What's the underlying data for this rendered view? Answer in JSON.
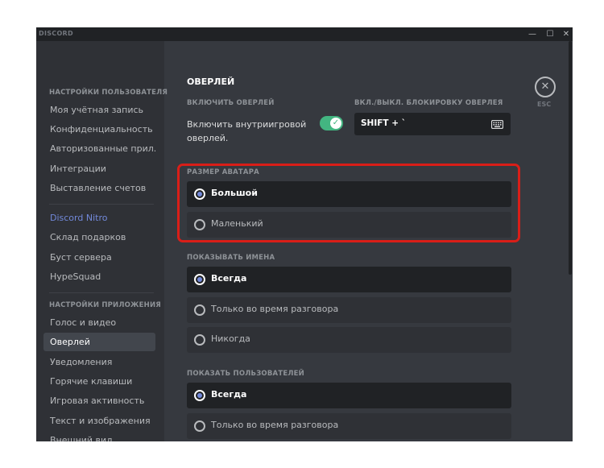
{
  "titlebar": {
    "app_name": "DISCORD",
    "minimize_glyph": "—",
    "maximize_glyph": "☐",
    "close_glyph": "✕"
  },
  "sidebar": {
    "user_settings_header": "НАСТРОЙКИ ПОЛЬЗОВАТЕЛЯ",
    "user_items": [
      {
        "label": "Моя учётная запись"
      },
      {
        "label": "Конфиденциальность"
      },
      {
        "label": "Авторизованные прил..."
      },
      {
        "label": "Интеграции"
      },
      {
        "label": "Выставление счетов"
      }
    ],
    "nitro_items": [
      {
        "label": "Discord Nitro"
      },
      {
        "label": "Склад подарков"
      },
      {
        "label": "Буст сервера"
      },
      {
        "label": "HypeSquad"
      }
    ],
    "app_settings_header": "НАСТРОЙКИ ПРИЛОЖЕНИЯ",
    "app_items": [
      {
        "label": "Голос и видео"
      },
      {
        "label": "Оверлей",
        "active": true
      },
      {
        "label": "Уведомления"
      },
      {
        "label": "Горячие клавиши"
      },
      {
        "label": "Игровая активность"
      },
      {
        "label": "Текст и изображения"
      },
      {
        "label": "Внешний вид"
      }
    ]
  },
  "content": {
    "title": "ОВЕРЛЕЙ",
    "close_glyph": "✕",
    "esc_label": "ESC",
    "enable_overlay": {
      "label": "ВКЛЮЧИТЬ ОВЕРЛЕЙ",
      "toggle_text": "Включить внутриигровой оверлей.",
      "enabled": true,
      "check_glyph": "✓"
    },
    "lock_keybind": {
      "label": "ВКЛ./ВЫКЛ. БЛОКИРОВКУ ОВЕРЛЕЯ",
      "value": "SHIFT + `"
    },
    "avatar_size": {
      "label": "РАЗМЕР АВАТАРА",
      "options": [
        {
          "label": "Большой",
          "selected": true
        },
        {
          "label": "Маленький",
          "selected": false
        }
      ]
    },
    "show_names": {
      "label": "ПОКАЗЫВАТЬ ИМЕНА",
      "options": [
        {
          "label": "Всегда",
          "selected": true
        },
        {
          "label": "Только во время разговора",
          "selected": false
        },
        {
          "label": "Никогда",
          "selected": false
        }
      ]
    },
    "show_users": {
      "label": "ПОКАЗАТЬ ПОЛЬЗОВАТЕЛЕЙ",
      "options": [
        {
          "label": "Всегда",
          "selected": true
        },
        {
          "label": "Только во время разговора",
          "selected": false
        }
      ]
    }
  },
  "colors": {
    "accent": "#7289da",
    "toggle_on": "#43b581",
    "highlight_box": "#d91e18"
  }
}
